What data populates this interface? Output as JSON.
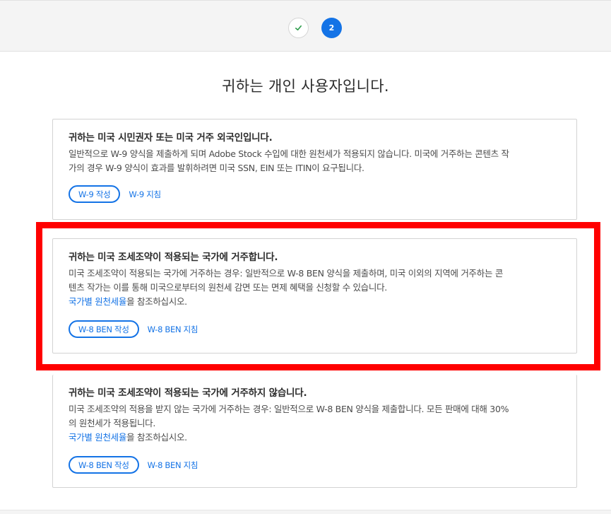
{
  "stepper": {
    "step2_label": "2"
  },
  "title": "귀하는 개인 사용자입니다.",
  "cards": [
    {
      "heading": "귀하는 미국 시민권자 또는 미국 거주 외국인입니다.",
      "desc_lines": [
        "일반적으로 W-9 양식을 제출하게 되며 Adobe Stock 수입에 대한 원천세가 적용되지 않습니다. 미국에 거주하는 콘텐츠 작",
        "가의 경우 W-9 양식이 효과를 발휘하려면 미국 SSN, EIN 또는 ITIN이 요구됩니다."
      ],
      "button_label": "W-9 작성",
      "guide_label": "W-9 지침"
    },
    {
      "heading": "귀하는 미국 조세조약이 적용되는 국가에 거주합니다.",
      "desc_lines": [
        "미국 조세조약이 적용되는 국가에 거주하는 경우: 일반적으로 W-8 BEN 양식을 제출하며, 미국 이외의 지역에 거주하는 콘",
        "텐츠 작가는 이를 통해 미국으로부터의 원천세 감면 또는 면제 혜택을 신청할 수 있습니다."
      ],
      "rate_link": "국가별 원천세율",
      "rate_suffix": "을 참조하십시오.",
      "button_label": "W-8 BEN 작성",
      "guide_label": "W-8 BEN 지침"
    },
    {
      "heading": "귀하는 미국 조세조약이 적용되는 국가에 거주하지 않습니다.",
      "desc_lines": [
        "미국 조세조약의 적용을 받지 않는 국가에 거주하는 경우: 일반적으로 W-8 BEN 양식을 제출합니다. 모든 판매에 대해 30%",
        "의 원천세가 적용됩니다."
      ],
      "rate_link": "국가별 원천세율",
      "rate_suffix": "을 참조하십시오.",
      "button_label": "W-8 BEN 작성",
      "guide_label": "W-8 BEN 지침"
    }
  ],
  "colors": {
    "accent": "#1473e6",
    "highlight": "#ff0000",
    "check": "#2d9d4b"
  },
  "icons": {
    "step1": "checkmark-icon"
  }
}
